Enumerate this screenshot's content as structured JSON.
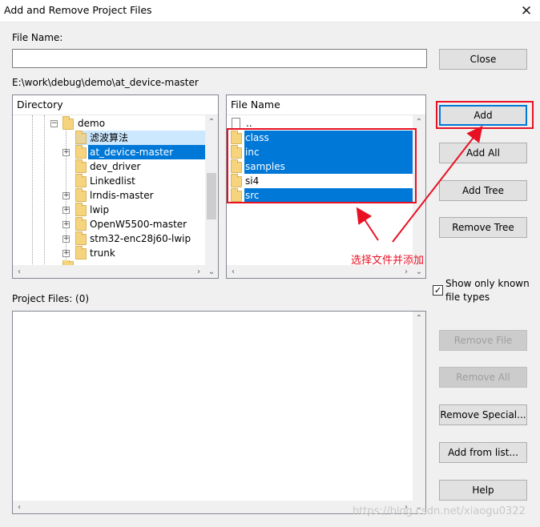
{
  "window": {
    "title": "Add and Remove Project Files",
    "close_glyph": "✕"
  },
  "file_name": {
    "label": "File Name:",
    "value": ""
  },
  "path": "E:\\work\\debug\\demo\\at_device-master",
  "directory": {
    "header": "Directory",
    "items": [
      {
        "label": "demo",
        "state": ""
      },
      {
        "label": "滤波算法",
        "state": ""
      },
      {
        "label": "at_device-master",
        "state": "selected"
      },
      {
        "label": "dev_driver",
        "state": ""
      },
      {
        "label": "Linkedlist",
        "state": ""
      },
      {
        "label": "lrndis-master",
        "state": ""
      },
      {
        "label": "lwip",
        "state": ""
      },
      {
        "label": "OpenW5500-master",
        "state": ""
      },
      {
        "label": "stm32-enc28j60-lwip",
        "state": ""
      },
      {
        "label": "trunk",
        "state": ""
      }
    ]
  },
  "files": {
    "header": "File Name",
    "items": [
      {
        "label": "..",
        "state": ""
      },
      {
        "label": "class",
        "state": "selected"
      },
      {
        "label": "inc",
        "state": "selected"
      },
      {
        "label": "samples",
        "state": "selected"
      },
      {
        "label": "si4",
        "state": ""
      },
      {
        "label": "src",
        "state": "selected"
      }
    ]
  },
  "buttons": {
    "close": "Close",
    "add": "Add",
    "add_all": "Add All",
    "add_tree": "Add Tree",
    "remove_tree": "Remove Tree",
    "remove_file": "Remove File",
    "remove_all": "Remove All",
    "remove_special": "Remove Special...",
    "add_from_list": "Add from list...",
    "help": "Help"
  },
  "show_known": {
    "label_line1": "Show only known",
    "label_line2": "file types",
    "checked_glyph": "✓"
  },
  "project_files": {
    "label": "Project Files: (0)"
  },
  "annotation": {
    "text": "选择文件并添加",
    "color": "#e81123"
  },
  "watermark": "https://blog.csdn.net/xiaogu0322",
  "colors": {
    "selection": "#0078d7",
    "selection_pale": "#cce8ff",
    "annotation_red": "#e81123"
  }
}
